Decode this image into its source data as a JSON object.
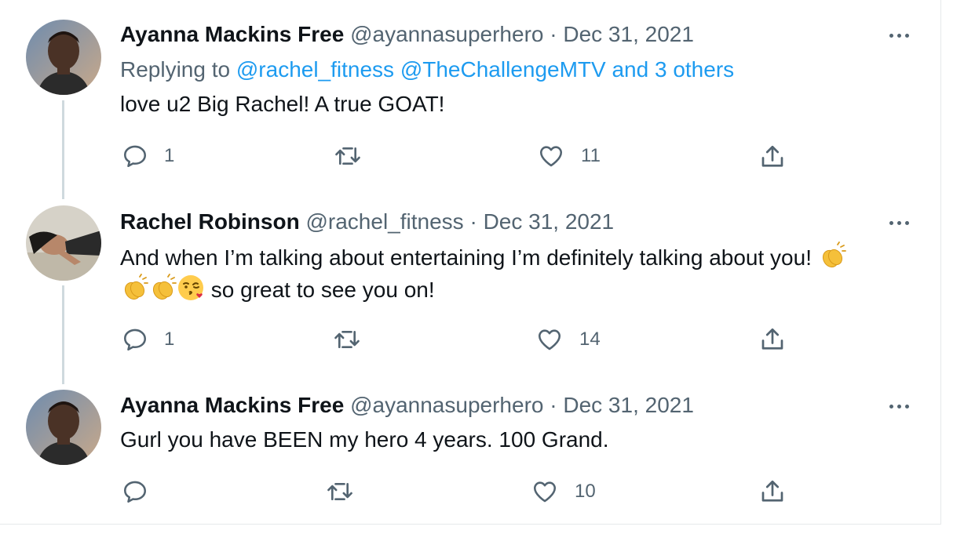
{
  "tweets": [
    {
      "name": "Ayanna Mackins Free",
      "handle": "@ayannasuperhero",
      "dot": "·",
      "date": "Dec 31, 2021",
      "replying_prefix": "Replying to ",
      "replying_links": "@rachel_fitness @TheChallengeMTV and 3 others",
      "text": "love u2 Big Rachel! A true GOAT!",
      "replies": "1",
      "retweets": "",
      "likes": "11"
    },
    {
      "name": "Rachel Robinson",
      "handle": "@rachel_fitness",
      "dot": "·",
      "date": "Dec 31, 2021",
      "text_part1": "And when I’m talking about entertaining I’m definitely talking about you!",
      "text_part2": "so great to see you on!",
      "emojis": [
        "clapping-hands",
        "clapping-hands",
        "clapping-hands",
        "face-blowing-kiss"
      ],
      "replies": "1",
      "retweets": "",
      "likes": "14"
    },
    {
      "name": "Ayanna Mackins Free",
      "handle": "@ayannasuperhero",
      "dot": "·",
      "date": "Dec 31, 2021",
      "text": "Gurl you have BEEN my hero 4 years.  100 Grand.",
      "replies": "",
      "retweets": "",
      "likes": "10"
    }
  ],
  "icons": {
    "reply": "reply-icon",
    "retweet": "retweet-icon",
    "like": "heart-icon",
    "share": "share-icon",
    "more": "more-icon"
  },
  "colors": {
    "text": "#0f1419",
    "secondary": "#536471",
    "link": "#1d9bf0",
    "thread_line": "#cfd9de"
  }
}
